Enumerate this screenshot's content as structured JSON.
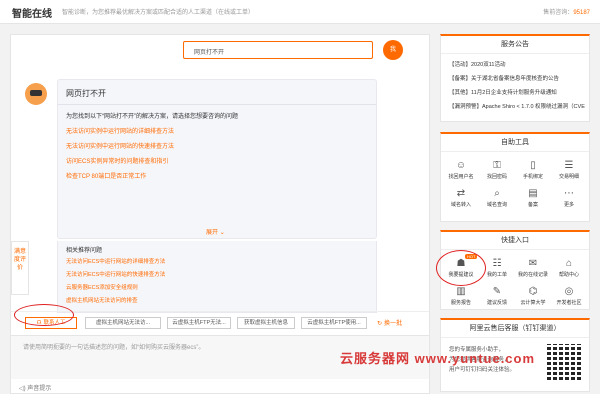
{
  "header": {
    "brand": "智能在线",
    "tagline": "智能诊断，为您推荐最优解决方案或匹配合适的人工渠道（在线或工单）",
    "hotline_label": "售前咨询：",
    "hotline_number": "95187"
  },
  "chat": {
    "user_question": "网页打不开",
    "user_avatar": "我",
    "answer_title": "网页打不开",
    "answer_intro": "为您找到以下“网站打不开”的解决方案，请选择您想要咨询的问题",
    "answer_links": [
      "无法访问实例中运行网站的详细排查方法",
      "无法访问实例中运行网站的快速排查方法",
      "访问ECS实例异常时的问题排查和指引",
      "检查TCP 80端口是否正常工作"
    ],
    "expand_label": "展开",
    "related_title": "相关推荐问题",
    "related_links": [
      "无法访问ECS中运行网站的详细排查方法",
      "无法访问ECS中运行网站的快速排查方法",
      "云服务器ECS添加安全组规则",
      "虚拟主机网站无法访问的排查"
    ],
    "feedback_label": "满意度评价",
    "quick_buttons": [
      "联系人工",
      "虚拟主机网站无法访...",
      "云虚拟主机FTP无法...",
      "获取虚拟主机信息",
      "云虚拟主机FTP使用..."
    ],
    "refresh_label": "换一批",
    "input_placeholder": "请使用简明扼要的一句话描述您的问题，如“如何购买云服务器ecs”。",
    "voice_label": "声音提示"
  },
  "announcements": {
    "title": "服务公告",
    "items": [
      "【活动】2020双11活动",
      "【备案】关于湖北省备案信息年度核查的公告",
      "【其他】11月2日企业支持计划服务升级通知",
      "【漏洞预警】Apache Shiro < 1.7.0 权限绕过漏洞（CVE..."
    ]
  },
  "self_tools": {
    "title": "自助工具",
    "items": [
      {
        "label": "找回用户名",
        "icon": "user-icon"
      },
      {
        "label": "找回密码",
        "icon": "lock-icon"
      },
      {
        "label": "手机绑定",
        "icon": "phone-icon"
      },
      {
        "label": "交易明细",
        "icon": "list-icon"
      },
      {
        "label": "域名转入",
        "icon": "transfer-icon"
      },
      {
        "label": "域名查询",
        "icon": "search-icon"
      },
      {
        "label": "备案",
        "icon": "doc-icon"
      },
      {
        "label": "更多",
        "icon": "more-icon"
      }
    ]
  },
  "quick_entry": {
    "title": "快捷入口",
    "hot_badge": "HOT",
    "items": [
      {
        "label": "我要提建议",
        "icon": "bot-icon"
      },
      {
        "label": "我的工单",
        "icon": "ticket-icon"
      },
      {
        "label": "我的在线记录",
        "icon": "chat-icon"
      },
      {
        "label": "帮助中心",
        "icon": "help-icon"
      },
      {
        "label": "服务报告",
        "icon": "chart-icon"
      },
      {
        "label": "建议反馈",
        "icon": "feedback-icon"
      },
      {
        "label": "云计算大学",
        "icon": "school-icon"
      },
      {
        "label": "开发者社区",
        "icon": "community-icon"
      }
    ]
  },
  "service_account": {
    "title": "阿里云售后客服（钉钉渠道）",
    "lines": [
      "您的专属服务小助手，",
      "为您提供客服咨询服务，",
      "用户可钉钉扫码关注体验。"
    ]
  },
  "watermark": "云服务器网 www.yuntue.com",
  "colors": {
    "accent": "#ff6a00",
    "annotation": "#e02020"
  }
}
